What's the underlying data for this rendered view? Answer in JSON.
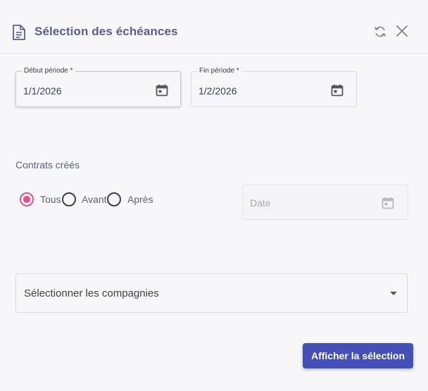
{
  "header": {
    "title": "Sélection des échéances",
    "icons": {
      "doc": "document-icon",
      "refresh": "refresh-icon",
      "close": "close-icon"
    }
  },
  "period": {
    "start": {
      "label": "Début période *",
      "value": "1/1/2026"
    },
    "end": {
      "label": "Fin période *",
      "value": "1/2/2026"
    }
  },
  "contracts": {
    "label": "Contrats créés",
    "options": [
      {
        "label": "Tous",
        "checked": true
      },
      {
        "label": "Avant",
        "checked": false
      },
      {
        "label": "Après",
        "checked": false
      }
    ],
    "date_placeholder": "Date"
  },
  "companies": {
    "placeholder": "Sélectionner les compagnies"
  },
  "actions": {
    "submit_label": "Afficher la sélection"
  },
  "colors": {
    "accent": "#4450b5",
    "radio_checked": "#e94c8a",
    "title": "#5a5d90"
  }
}
